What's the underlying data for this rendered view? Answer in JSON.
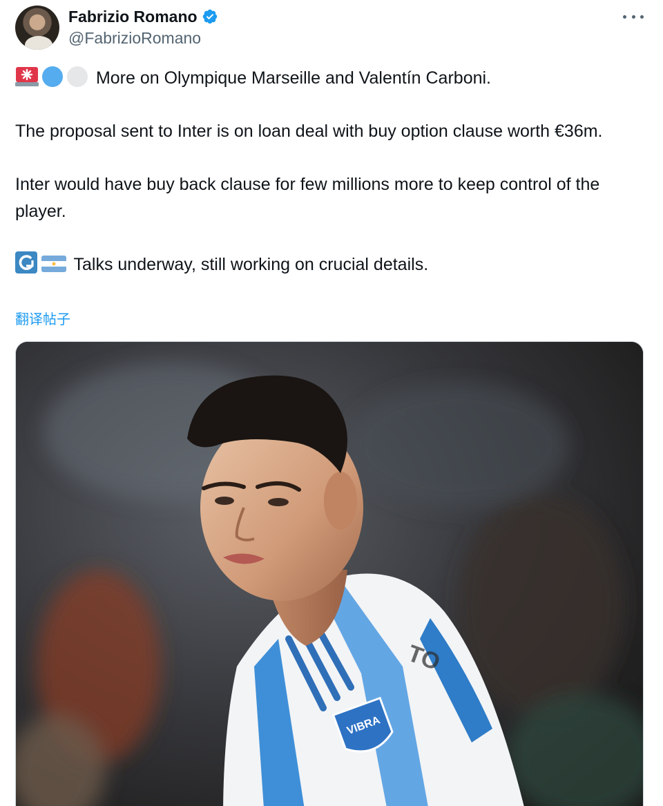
{
  "author": {
    "display_name": "Fabrizio Romano",
    "handle": "@FabrizioRomano",
    "verified": true
  },
  "tweet": {
    "line1_emojis": [
      "siren-emoji",
      "blue-circle-emoji",
      "white-circle-emoji"
    ],
    "line1": "More on Olympique Marseille and Valentín Carboni.",
    "line2": "The proposal sent to Inter is on loan deal with buy option clause worth €36m.",
    "line3": "Inter would have buy back clause for few millions more to keep control of the player.",
    "line4_emojis": [
      "return-arrow-emoji",
      "argentina-flag-emoji"
    ],
    "line4": "Talks underway, still working on crucial details.",
    "translate_label": "翻译帖子"
  },
  "media": {
    "badge_text": "VIBRA",
    "shirt_text": "TO"
  },
  "colors": {
    "link": "#1d9bf0",
    "secondary_text": "#536471",
    "verified": "#1d9bf0"
  },
  "icons": {
    "more": "more-horizontal-icon",
    "verified": "verified-badge-icon"
  }
}
